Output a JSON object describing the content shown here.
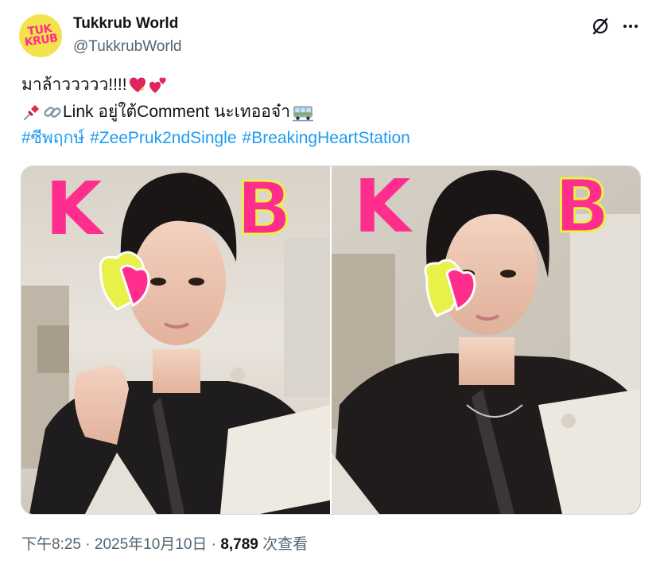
{
  "author": {
    "avatar_text": "TUK\nKRUB",
    "display_name": "Tukkrub World",
    "handle": "@TukkrubWorld"
  },
  "tweet": {
    "line1_text": "มาล้าววววว!!!!",
    "line2_link": "Link",
    "line2_text": " อยู่ใต้Comment นะเทออจ๋า",
    "hashtags": [
      "#ซีพฤกษ์",
      "#ZeePruk2ndSingle",
      "#BreakingHeartStation"
    ]
  },
  "icons": {
    "grok": "grok-icon",
    "more": "more-options-icon",
    "pin": "pushpin-emoji",
    "link": "link-emoji",
    "heart_sparkle": "sparkling-heart-emoji",
    "two_hearts": "two-hearts-emoji",
    "train": "railway-car-emoji"
  },
  "colors": {
    "hashtag": "#1d9bf0",
    "secondary_text": "#536471",
    "avatar_bg": "#f4e24c",
    "avatar_text": "#ff2d8c",
    "poster_pink": "#ff2d8c",
    "poster_yellow": "#e8f04a"
  },
  "meta": {
    "time": "下午8:25",
    "separator": "·",
    "date": "2025年10月10日",
    "views_count": "8,789",
    "views_label": "次查看"
  },
  "media": {
    "photo_count": 2,
    "poster_text_left": "KRUB",
    "poster_text_right": "UB"
  }
}
